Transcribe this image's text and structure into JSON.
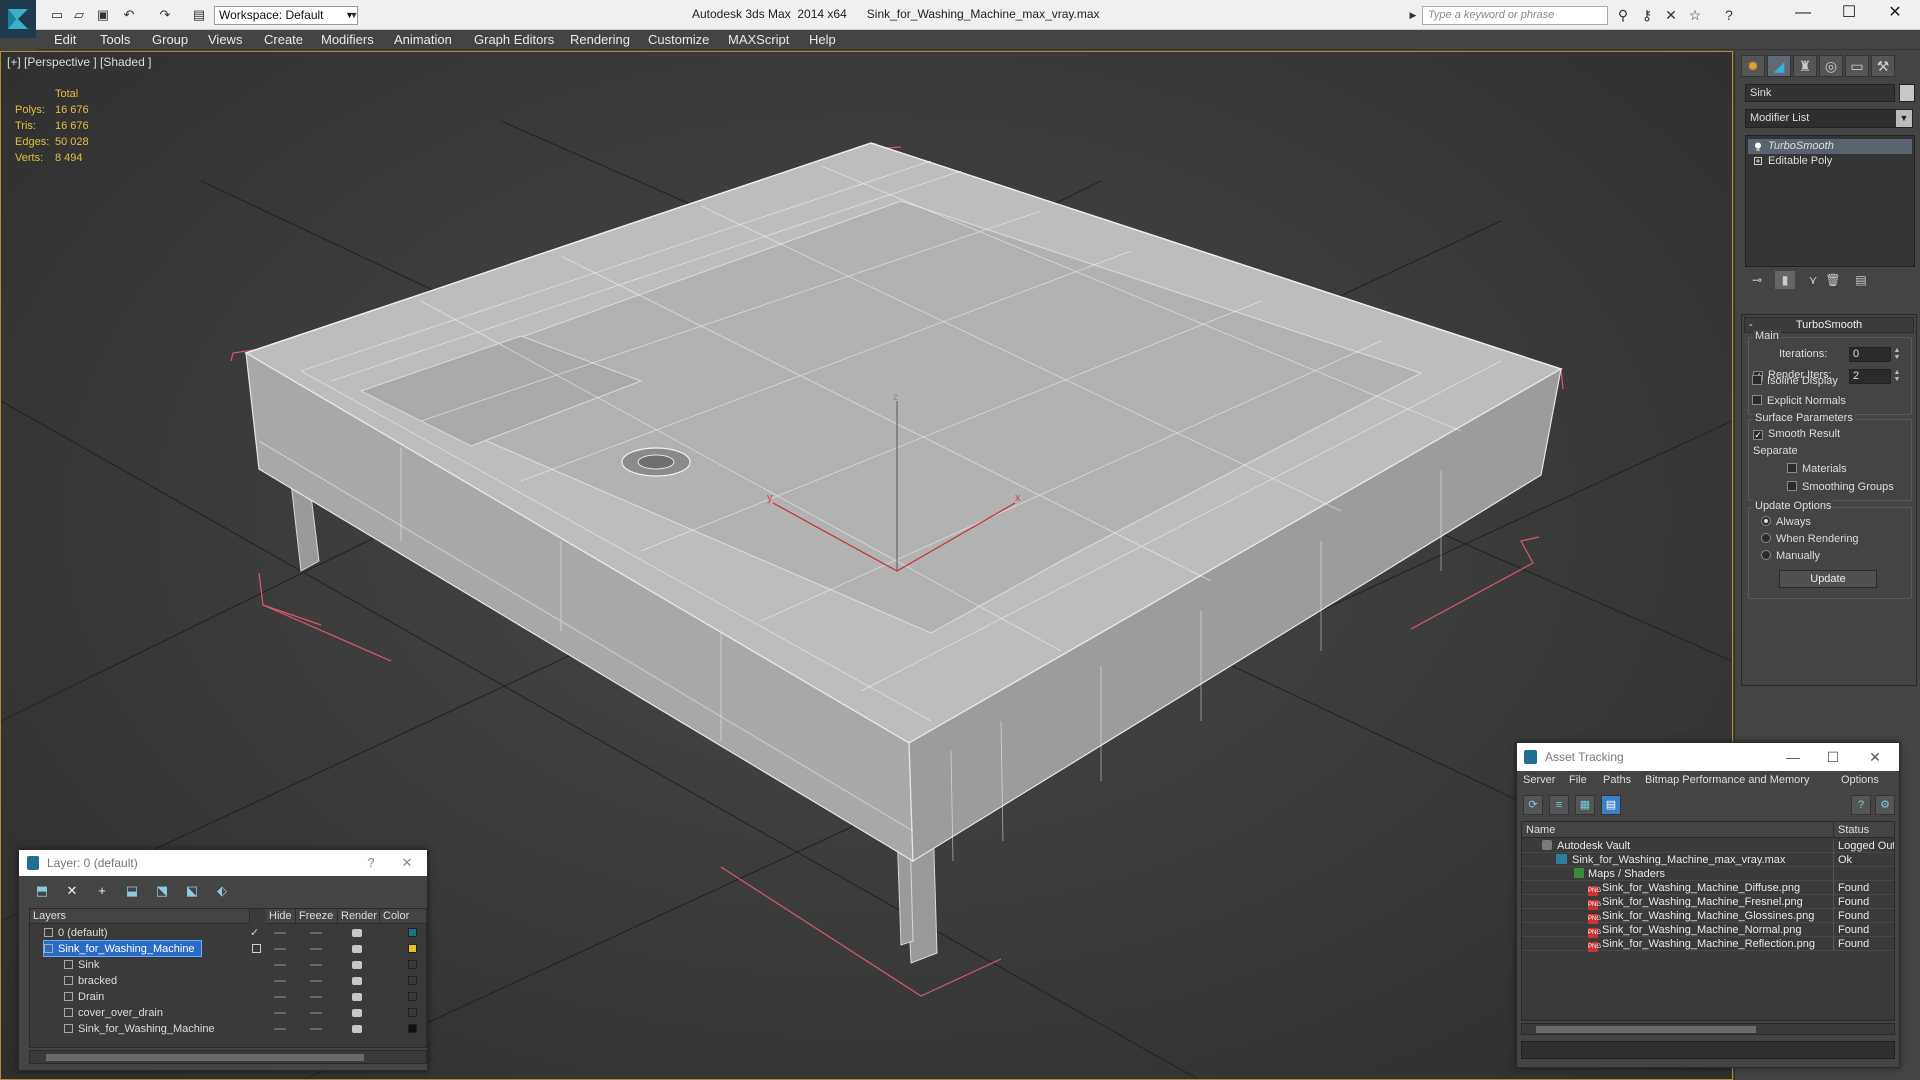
{
  "titlebar": {
    "workspace": "Workspace: Default",
    "title": "Autodesk 3ds Max  2014 x64      Sink_for_Washing_Machine_max_vray.max",
    "search_placeholder": "Type a keyword or phrase"
  },
  "menu": [
    "Edit",
    "Tools",
    "Group",
    "Views",
    "Create",
    "Modifiers",
    "Animation",
    "Graph Editors",
    "Rendering",
    "Customize",
    "MAXScript",
    "Help"
  ],
  "viewport": {
    "label": "[+] [Perspective ] [Shaded ]",
    "stats": {
      "header": "Total",
      "rows": [
        {
          "label": "Polys:",
          "value": "16 676"
        },
        {
          "label": "Tris:",
          "value": "16 676"
        },
        {
          "label": "Edges:",
          "value": "50 028"
        },
        {
          "label": "Verts:",
          "value": "8 494"
        }
      ]
    },
    "gizmo": {
      "x_label": "x",
      "y_label": "y",
      "z_label": "z"
    }
  },
  "command_panel": {
    "object_name": "Sink",
    "modifier_list": "Modifier List",
    "stack": [
      {
        "label": "TurboSmooth",
        "selected": true
      },
      {
        "label": "Editable Poly",
        "selected": false
      }
    ],
    "rollout": {
      "title": "TurboSmooth",
      "main": "Main",
      "iterations_label": "Iterations:",
      "iterations_value": "0",
      "render_iters_label": "Render Iters:",
      "render_iters_value": "2",
      "render_iters_checked": true,
      "isoline_display": "Isoline Display",
      "explicit_normals": "Explicit Normals",
      "surface_parameters": "Surface Parameters",
      "smooth_result": "Smooth Result",
      "separate": "Separate",
      "materials": "Materials",
      "smoothing_groups": "Smoothing Groups",
      "update_options": "Update Options",
      "always": "Always",
      "when_rendering": "When Rendering",
      "manually": "Manually",
      "update_button": "Update"
    }
  },
  "asset_tracking": {
    "title": "Asset Tracking",
    "menu": [
      "Server",
      "File",
      "Paths",
      "Bitmap Performance and Memory",
      "Options"
    ],
    "columns": {
      "name": "Name",
      "status": "Status"
    },
    "rows": [
      {
        "name": "Autodesk Vault",
        "status": "Logged Out",
        "type": "vault",
        "indent": 1
      },
      {
        "name": "Sink_for_Washing_Machine_max_vray.max",
        "status": "Ok",
        "type": "max",
        "indent": 2
      },
      {
        "name": "Maps / Shaders",
        "status": "",
        "type": "maps",
        "indent": 3
      },
      {
        "name": "Sink_for_Washing_Machine_Diffuse.png",
        "status": "Found",
        "type": "png",
        "indent": 4
      },
      {
        "name": "Sink_for_Washing_Machine_Fresnel.png",
        "status": "Found",
        "type": "png",
        "indent": 4
      },
      {
        "name": "Sink_for_Washing_Machine_Glossines.png",
        "status": "Found",
        "type": "png",
        "indent": 4
      },
      {
        "name": "Sink_for_Washing_Machine_Normal.png",
        "status": "Found",
        "type": "png",
        "indent": 4
      },
      {
        "name": "Sink_for_Washing_Machine_Reflection.png",
        "status": "Found",
        "type": "png",
        "indent": 4
      }
    ]
  },
  "layer_manager": {
    "title": "Layer: 0 (default)",
    "help": "?",
    "columns": {
      "layers": "Layers",
      "hide": "Hide",
      "freeze": "Freeze",
      "render": "Render",
      "color": "Color"
    },
    "rows": [
      {
        "name": "0 (default)",
        "color": "#1d6f8a",
        "selected": false,
        "child": false,
        "current": true
      },
      {
        "name": "Sink_for_Washing_Machine",
        "color": "#e8c020",
        "selected": true,
        "child": false,
        "current": false
      },
      {
        "name": "Sink",
        "color": "#3a3a3a",
        "selected": false,
        "child": true,
        "current": false
      },
      {
        "name": "bracked",
        "color": "#3a3a3a",
        "selected": false,
        "child": true,
        "current": false
      },
      {
        "name": "Drain",
        "color": "#3a3a3a",
        "selected": false,
        "child": true,
        "current": false
      },
      {
        "name": "cover_over_drain",
        "color": "#3a3a3a",
        "selected": false,
        "child": true,
        "current": false
      },
      {
        "name": "Sink_for_Washing_Machine",
        "color": "#111111",
        "selected": false,
        "child": true,
        "current": false
      }
    ]
  }
}
